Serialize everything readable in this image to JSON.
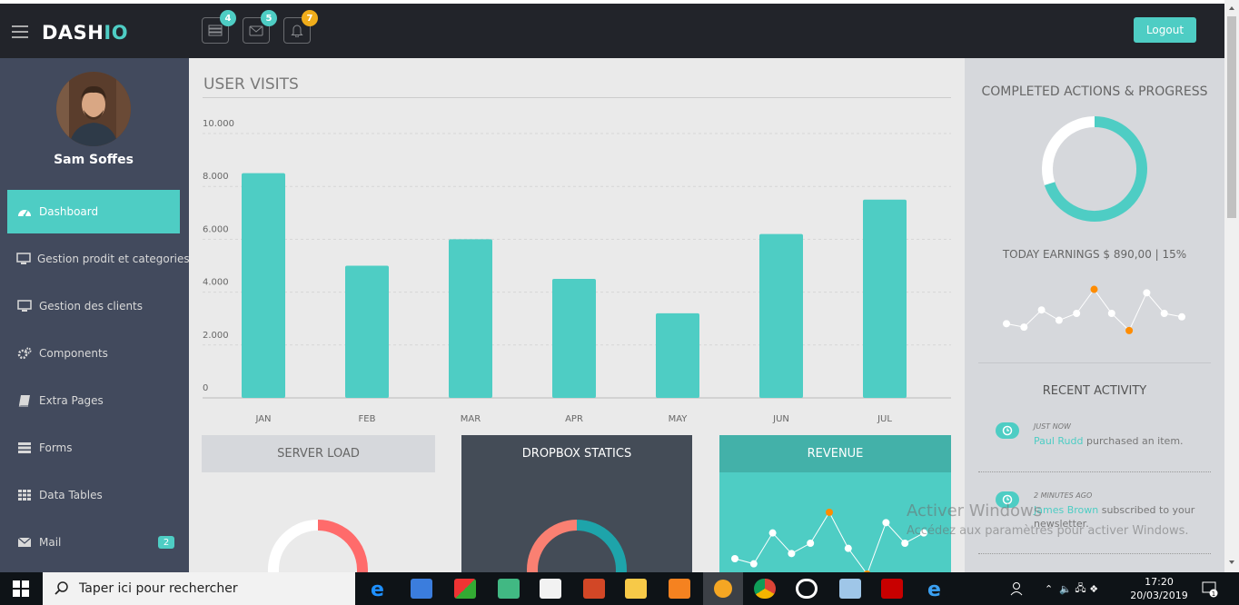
{
  "app": {
    "logo_main": "DASH",
    "logo_accent": "IO"
  },
  "topbar": {
    "notifications": [
      {
        "icon": "tasks-icon",
        "count": "4",
        "color": "#4ecdc4"
      },
      {
        "icon": "envelope-icon",
        "count": "5",
        "color": "#4ecdc4"
      },
      {
        "icon": "bell-icon",
        "count": "7",
        "color": "#f0ad1b"
      }
    ],
    "logout_label": "Logout"
  },
  "sidebar": {
    "user_name": "Sam Soffes",
    "items": [
      {
        "label": "Dashboard",
        "icon": "dashboard-icon",
        "active": true
      },
      {
        "label": "Gestion prodit et categories",
        "icon": "desktop-icon"
      },
      {
        "label": "Gestion des clients",
        "icon": "desktop-icon"
      },
      {
        "label": "Components",
        "icon": "cogs-icon"
      },
      {
        "label": "Extra Pages",
        "icon": "book-icon"
      },
      {
        "label": "Forms",
        "icon": "tasks-icon"
      },
      {
        "label": "Data Tables",
        "icon": "th-icon"
      },
      {
        "label": "Mail",
        "icon": "envelope-icon",
        "badge": "2"
      }
    ]
  },
  "main": {
    "section_title": "USER VISITS",
    "panels": {
      "server_load": "SERVER LOAD",
      "dropbox": "DROPBOX STATICS",
      "revenue": "REVENUE"
    }
  },
  "chart_data": [
    {
      "type": "bar",
      "categories": [
        "JAN",
        "FEB",
        "MAR",
        "APR",
        "MAY",
        "JUN",
        "JUL"
      ],
      "values": [
        8500,
        5000,
        6000,
        4500,
        3200,
        6200,
        7500
      ],
      "y_ticks": [
        "0",
        "2.000",
        "4.000",
        "6.000",
        "8.000",
        "10.000"
      ],
      "ylim": [
        0,
        10000
      ],
      "grid": true,
      "color": "#4ecdc4"
    },
    {
      "type": "pie",
      "values": [
        70,
        30
      ],
      "colors": [
        "#4ecdc4",
        "#ffffff"
      ]
    },
    {
      "type": "line",
      "values": [
        3,
        2.5,
        5,
        3.5,
        4.5,
        8,
        4.5,
        2,
        7.5,
        4.5,
        4
      ],
      "highlight_points": [
        5,
        7
      ],
      "highlight_color": "#ff8c00"
    },
    {
      "type": "pie",
      "values": [
        55,
        45
      ],
      "colors": [
        "#ff6b6b",
        "#ffffff"
      ]
    },
    {
      "type": "pie",
      "values": [
        50,
        50
      ],
      "colors": [
        "#1ea4aa",
        "#fa8072"
      ]
    },
    {
      "type": "line",
      "values": [
        1.5,
        1,
        4,
        2,
        3,
        6,
        2.5,
        0,
        5,
        3,
        4
      ],
      "highlight_points": [
        5,
        7
      ],
      "highlight_color": "#ff8c00"
    }
  ],
  "right": {
    "completed_title": "COMPLETED ACTIONS & PROGRESS",
    "earnings_label": "TODAY EARNINGS $ 890,00 | 15%",
    "recent_title": "RECENT ACTIVITY",
    "activities": [
      {
        "time": "JUST NOW",
        "name": "Paul Rudd",
        "text": " purchased an item."
      },
      {
        "time": "2 MINUTES AGO",
        "name": "James Brown",
        "text": " subscribed to your newsletter."
      }
    ]
  },
  "watermark": {
    "line1": "Activer Windows",
    "line2": "Accédez aux paramètres pour activer Windows."
  },
  "taskbar": {
    "search_placeholder": "Taper ici pour rechercher",
    "time": "17:20",
    "date": "20/03/2019",
    "notification_count": "1"
  }
}
